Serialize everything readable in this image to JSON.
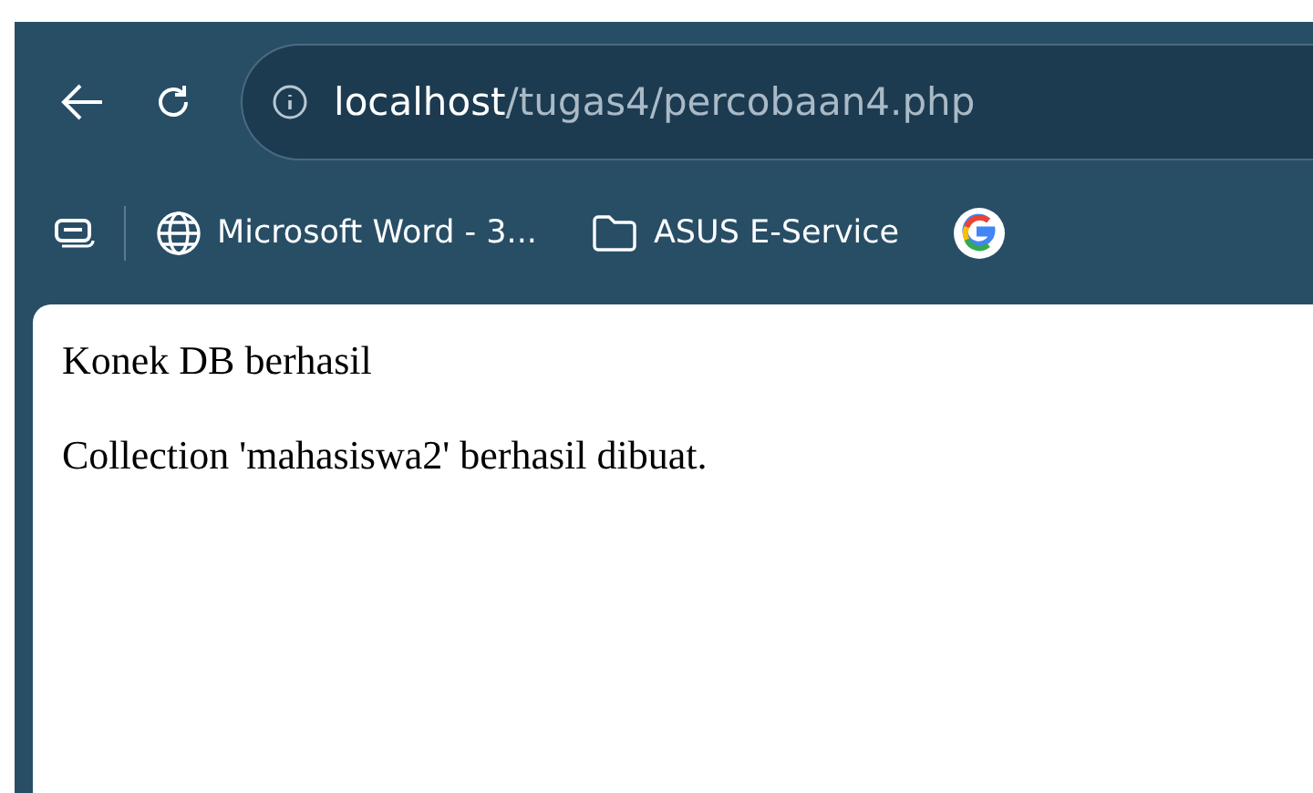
{
  "address_bar": {
    "host": "localhost",
    "path": "/tugas4/percobaan4.php"
  },
  "bookmarks": [
    {
      "kind": "globe",
      "label": "Microsoft Word - 3..."
    },
    {
      "kind": "folder",
      "label": "ASUS E-Service"
    },
    {
      "kind": "google"
    }
  ],
  "page": {
    "lines": [
      "Konek DB berhasil",
      "Collection 'mahasiswa2' berhasil dibuat."
    ]
  }
}
